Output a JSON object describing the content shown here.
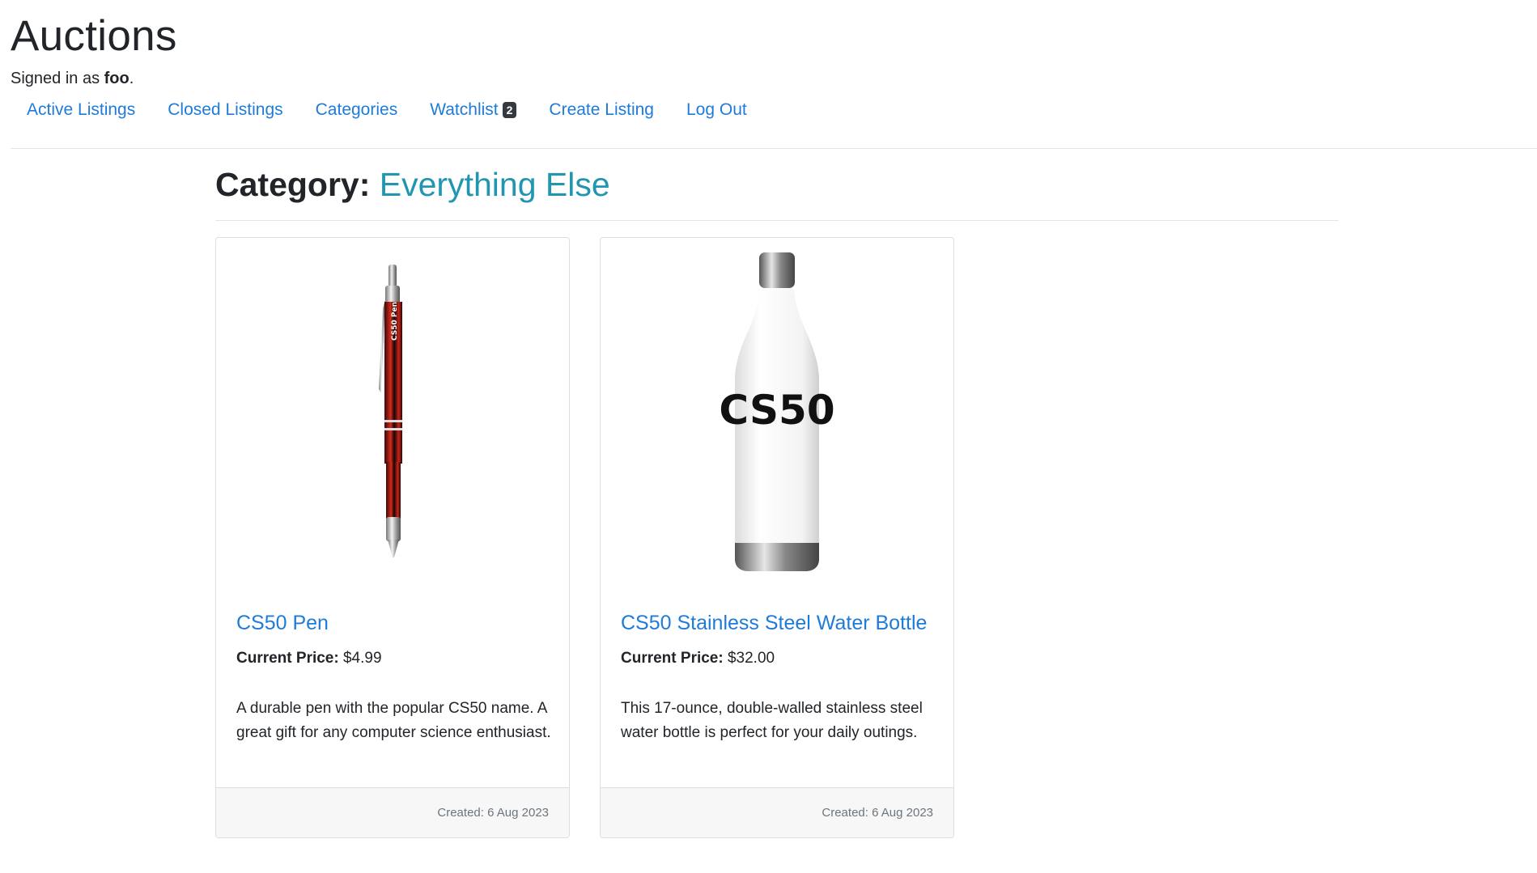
{
  "header": {
    "title": "Auctions",
    "signed_in_prefix": "Signed in as",
    "username": "foo",
    "signed_in_suffix": "."
  },
  "nav": {
    "active_listings": "Active Listings",
    "closed_listings": "Closed Listings",
    "categories": "Categories",
    "watchlist": "Watchlist",
    "watchlist_count": "2",
    "create_listing": "Create Listing",
    "log_out": "Log Out"
  },
  "category": {
    "label": "Category:",
    "name": "Everything Else"
  },
  "listings": [
    {
      "title": "CS50 Pen",
      "price_label": "Current Price:",
      "price": "$4.99",
      "description": "A durable pen with the popular CS50 name. A great gift for any computer science enthusiast.",
      "created": "Created: 6 Aug 2023",
      "image_text": "CS50 Pen"
    },
    {
      "title": "CS50 Stainless Steel Water Bottle",
      "price_label": "Current Price:",
      "price": "$32.00",
      "description": "This 17-ounce, double-walled stainless steel water bottle is perfect for your daily outings.",
      "created": "Created: 6 Aug 2023",
      "image_text": "CS50"
    }
  ],
  "colors": {
    "link": "#1f7bd8",
    "category_accent": "#2196b0",
    "badge": "#343a40"
  }
}
